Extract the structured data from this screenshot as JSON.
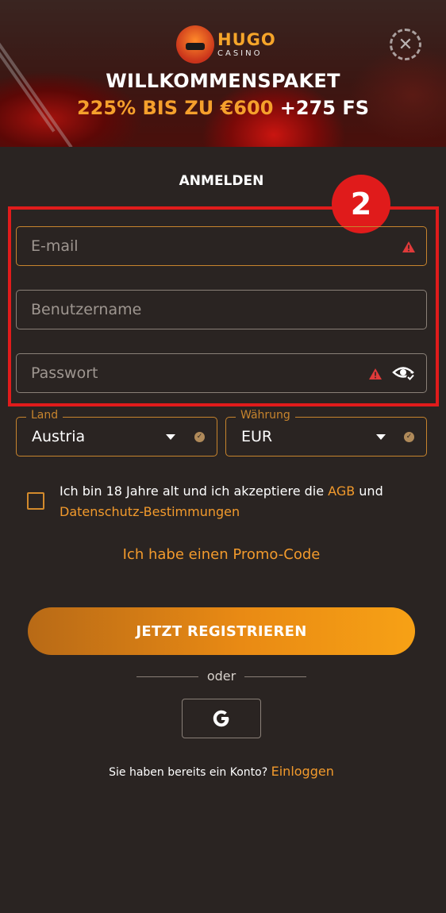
{
  "banner": {
    "logo_name": "HUGO",
    "logo_sub": "CASINO",
    "title": "WILLKOMMENSPAKET",
    "offer_orange": "225% BIS ZU €600",
    "offer_white": "+275 FS"
  },
  "form": {
    "title": "ANMELDEN",
    "step_badge": "2",
    "email_placeholder": "E-mail",
    "username_placeholder": "Benutzername",
    "password_placeholder": "Passwort",
    "country": {
      "label": "Land",
      "value": "Austria"
    },
    "currency": {
      "label": "Währung",
      "value": "EUR"
    },
    "terms_text_1": "Ich bin 18 Jahre alt und ich akzeptiere die ",
    "terms_link_1": "AGB",
    "terms_text_2": " und ",
    "terms_link_2": "Datenschutz-Bestimmungen",
    "promo_link": "Ich habe einen Promo-Code",
    "submit_label": "JETZT REGISTRIEREN",
    "or_label": "oder",
    "google_label": "G",
    "login_prompt": "Sie haben bereits ein Konto?",
    "login_link": "Einloggen"
  },
  "colors": {
    "background": "#2a2422",
    "accent": "#f29a2c",
    "highlight_frame": "#e01b1b",
    "warning": "#e03a3a"
  },
  "icons": [
    "close-icon",
    "warning-icon",
    "eye-icon",
    "caret-down-icon",
    "check-icon",
    "google-icon"
  ]
}
